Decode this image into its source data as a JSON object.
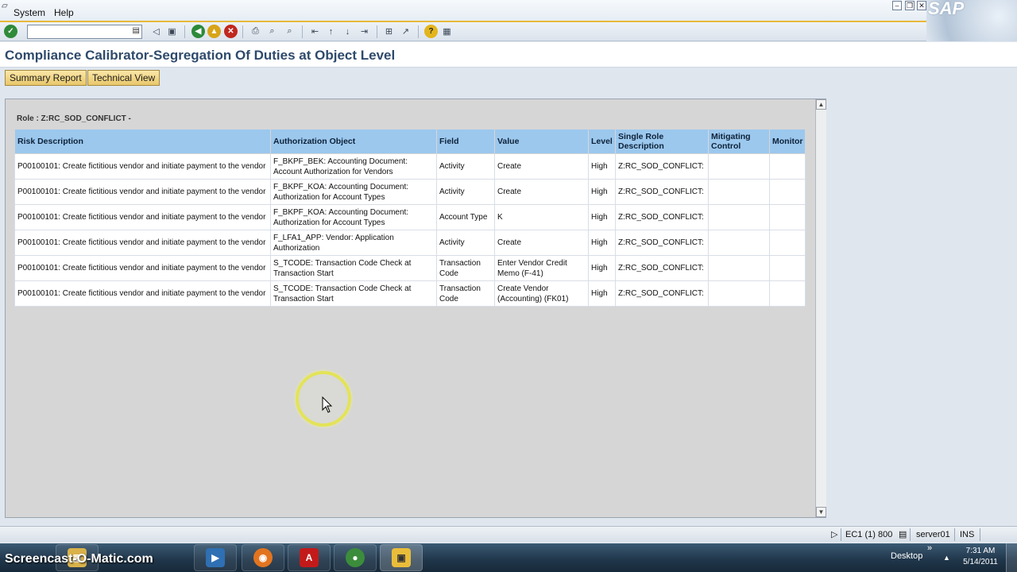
{
  "menu": {
    "system": "System",
    "help": "Help"
  },
  "brand": {
    "logo_text": "SAP"
  },
  "toolbar": {
    "command_value": "",
    "icons": [
      "enter-icon",
      "back-icon",
      "save-icon",
      "back-nav-icon",
      "exit-icon",
      "cancel-icon",
      "print-icon",
      "find-icon",
      "find-next-icon",
      "first-page-icon",
      "previous-page-icon",
      "next-page-icon",
      "last-page-icon",
      "create-session-icon",
      "shortcut-icon",
      "help-icon",
      "layout-icon"
    ]
  },
  "title": "Compliance Calibrator-Segregation Of Duties at Object Level",
  "buttons": {
    "summary": "Summary Report",
    "technical": "Technical View"
  },
  "report": {
    "role_label": "Role : Z:RC_SOD_CONFLICT -",
    "columns": [
      "Risk Description",
      "Authorization Object",
      "Field",
      "Value",
      "Level",
      "Single Role Description",
      "Mitigating Control",
      "Monitor"
    ],
    "rows": [
      [
        "P00100101: Create fictitious vendor and initiate payment to the vendor",
        "F_BKPF_BEK: Accounting Document: Account Authorization for Vendors",
        "Activity",
        "Create",
        "High",
        "Z:RC_SOD_CONFLICT:",
        "",
        ""
      ],
      [
        "P00100101: Create fictitious vendor and initiate payment to the vendor",
        "F_BKPF_KOA: Accounting Document: Authorization for Account Types",
        "Activity",
        "Create",
        "High",
        "Z:RC_SOD_CONFLICT:",
        "",
        ""
      ],
      [
        "P00100101: Create fictitious vendor and initiate payment to the vendor",
        "F_BKPF_KOA: Accounting Document: Authorization for Account Types",
        "Account Type",
        "K",
        "High",
        "Z:RC_SOD_CONFLICT:",
        "",
        ""
      ],
      [
        "P00100101: Create fictitious vendor and initiate payment to the vendor",
        "F_LFA1_APP: Vendor: Application Authorization",
        "Activity",
        "Create",
        "High",
        "Z:RC_SOD_CONFLICT:",
        "",
        ""
      ],
      [
        "P00100101: Create fictitious vendor and initiate payment to the vendor",
        "S_TCODE: Transaction Code Check at Transaction Start",
        "Transaction Code",
        "Enter Vendor Credit Memo (F-41)",
        "High",
        "Z:RC_SOD_CONFLICT:",
        "",
        ""
      ],
      [
        "P00100101: Create fictitious vendor and initiate payment to the vendor",
        "S_TCODE: Transaction Code Check at Transaction Start",
        "Transaction Code",
        "Create Vendor (Accounting) (FK01)",
        "High",
        "Z:RC_SOD_CONFLICT:",
        "",
        ""
      ]
    ]
  },
  "status": {
    "system": "EC1 (1) 800",
    "server": "server01",
    "mode": "INS"
  },
  "taskbar": {
    "watermark": "Screencast-O-Matic.com",
    "desktop": "Desktop",
    "time": "7:31 AM",
    "date": "5/14/2011",
    "apps": [
      "explorer-icon",
      "media-player-icon",
      "firefox-icon",
      "acrobat-icon",
      "chrome-icon",
      "sap-logon-icon"
    ]
  },
  "colors": {
    "header_blue": "#9cc8ee",
    "title_blue": "#2e4a6c",
    "button_gold": "#e9c76a"
  }
}
